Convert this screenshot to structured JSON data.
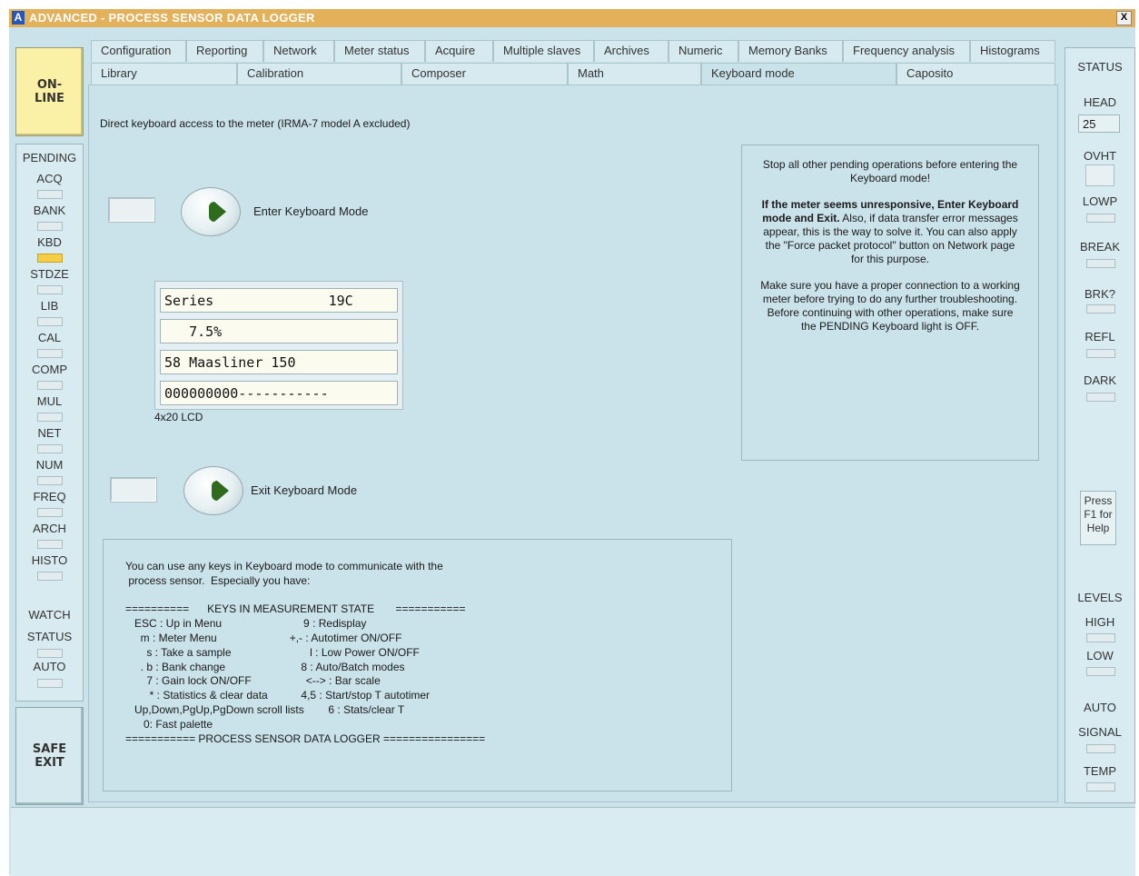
{
  "window": {
    "app_letter": "A",
    "title": "ADVANCED - PROCESS SENSOR DATA LOGGER",
    "close_label": "X"
  },
  "left": {
    "online_label": "ON-\nLINE",
    "pending_title": "PENDING",
    "pending_items": [
      {
        "label": "ACQ",
        "on": false
      },
      {
        "label": "BANK",
        "on": false
      },
      {
        "label": "KBD",
        "on": true
      },
      {
        "label": "STDZE",
        "on": false
      },
      {
        "label": "LIB",
        "on": false
      },
      {
        "label": "CAL",
        "on": false
      },
      {
        "label": "COMP",
        "on": false
      },
      {
        "label": "MUL",
        "on": false
      },
      {
        "label": "NET",
        "on": false
      },
      {
        "label": "NUM",
        "on": false
      },
      {
        "label": "FREQ",
        "on": false
      },
      {
        "label": "ARCH",
        "on": false
      },
      {
        "label": "HISTO",
        "on": false
      }
    ],
    "watch": "WATCH",
    "status": "STATUS",
    "auto": "AUTO",
    "safe_exit_label": "SAFE\nEXIT"
  },
  "tabs": {
    "row1": [
      "Configuration",
      "Reporting",
      "Network",
      "Meter status",
      "Acquire",
      "Multiple slaves",
      "Archives",
      "Numeric",
      "Memory Banks",
      "Frequency analysis",
      "Histograms"
    ],
    "row2": [
      "Library",
      "Calibration",
      "Composer",
      "Math",
      "Keyboard mode",
      "Caposito"
    ],
    "active": "Keyboard mode"
  },
  "main": {
    "description": "Direct keyboard access to the meter (IRMA-7 model A excluded)",
    "enter_label": "Enter Keyboard Mode",
    "exit_label": "Exit Keyboard Mode",
    "lcd_lines": [
      "Series              19C",
      "   7.5%",
      "58 Maasliner 150",
      "000000000-----------"
    ],
    "lcd_caption": "4x20 LCD",
    "info": {
      "p1": "Stop all other pending operations before entering the Keyboard mode!",
      "p2_bold": "If the meter seems unresponsive, Enter Keyboard mode and Exit.",
      "p2_rest": " Also, if data transfer error messages appear, this is the way to solve it. You can also apply the \"Force packet protocol\" button on Network page for this purpose.",
      "p3": "Make sure you have a proper connection to a working meter before trying to do any further troubleshooting. Before continuing with other operations, make sure the PENDING Keyboard light is OFF."
    },
    "keys_text": "You can use any keys in Keyboard mode to communicate with the\n process sensor.  Especially you have:\n\n==========      KEYS IN MEASUREMENT STATE       ===========\n   ESC : Up in Menu                           9 : Redisplay\n     m : Meter Menu                        +,- : Autotimer ON/OFF\n       s : Take a sample                          l : Low Power ON/OFF\n     . b : Bank change                         8 : Auto/Batch modes\n       7 : Gain lock ON/OFF                  <--> : Bar scale\n        * : Statistics & clear data           4,5 : Start/stop T autotimer\n   Up,Down,PgUp,PgDown scroll lists        6 : Stats/clear T\n      0: Fast palette\n=========== PROCESS SENSOR DATA LOGGER ================"
  },
  "right": {
    "status_title": "STATUS",
    "head_label": "HEAD",
    "head_value": "25",
    "ovht": "OVHT",
    "lowp": "LOWP",
    "break": "BREAK",
    "brk_q": "BRK?",
    "refl": "REFL",
    "dark": "DARK",
    "help_label": "Press\nF1 for\nHelp",
    "levels": "LEVELS",
    "high": "HIGH",
    "low": "LOW",
    "auto": "AUTO",
    "signal": "SIGNAL",
    "temp": "TEMP"
  },
  "colors": {
    "panel": "#cae2e9",
    "title_bar": "#e3b15a",
    "online_button": "#fbf1a6",
    "led_on": "#f4cf46"
  }
}
